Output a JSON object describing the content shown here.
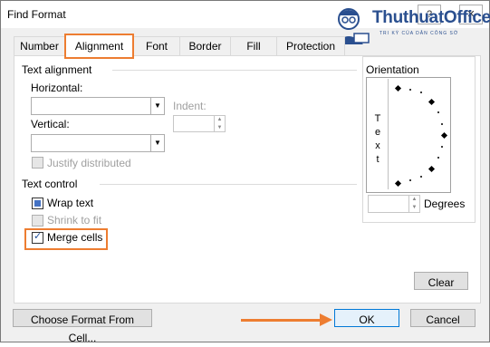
{
  "window": {
    "title": "Find Format",
    "help_label": "?",
    "close_label": "✕"
  },
  "logo": {
    "name": "ThuthuatOffice",
    "tagline": "TRI KỲ CỦA DÂN CÔNG SỞ"
  },
  "tabs": [
    {
      "label": "Number"
    },
    {
      "label": "Alignment",
      "active": true
    },
    {
      "label": "Font"
    },
    {
      "label": "Border"
    },
    {
      "label": "Fill"
    },
    {
      "label": "Protection"
    }
  ],
  "text_alignment": {
    "group_label": "Text alignment",
    "horizontal_label": "Horizontal:",
    "horizontal_value": "",
    "vertical_label": "Vertical:",
    "vertical_value": "",
    "indent_label": "Indent:",
    "indent_value": "",
    "justify_distributed_label": "Justify distributed"
  },
  "text_control": {
    "group_label": "Text control",
    "wrap_text_label": "Wrap text",
    "shrink_to_fit_label": "Shrink to fit",
    "merge_cells_label": "Merge cells",
    "merge_cells_checked": true
  },
  "orientation": {
    "group_label": "Orientation",
    "vertical_text": [
      "T",
      "e",
      "x",
      "t"
    ],
    "degrees_label": "Degrees",
    "degrees_value": ""
  },
  "buttons": {
    "clear": "Clear",
    "choose_format": "Choose Format From Cell...",
    "ok": "OK",
    "cancel": "Cancel"
  },
  "colors": {
    "highlight": "#ed7d31",
    "ok_border": "#0078d7"
  }
}
